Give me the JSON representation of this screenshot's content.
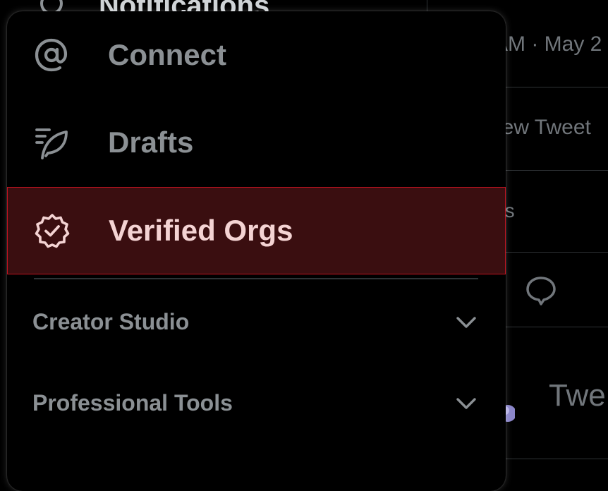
{
  "background": {
    "nav_label": "Notifications",
    "timestamp_fragment": "AM · May 2",
    "view_tweet_fragment": "iew Tweet",
    "likes_fragment": "es",
    "tweet_fragment": "Twe"
  },
  "menu": {
    "items": [
      {
        "label": "Connect",
        "icon": "at-sign-icon"
      },
      {
        "label": "Drafts",
        "icon": "feather-quill-icon"
      },
      {
        "label": "Verified Orgs",
        "icon": "verified-badge-icon",
        "highlighted": true
      }
    ],
    "sections": [
      {
        "label": "Creator Studio",
        "icon": "chevron-down-icon"
      },
      {
        "label": "Professional Tools",
        "icon": "chevron-down-icon"
      }
    ]
  },
  "colors": {
    "background": "#000000",
    "muted_text": "#8b9094",
    "highlight_bg": "#3a0e10",
    "highlight_border": "#c1121f",
    "highlight_text": "#f4d3d3",
    "divider": "#2f3336"
  }
}
